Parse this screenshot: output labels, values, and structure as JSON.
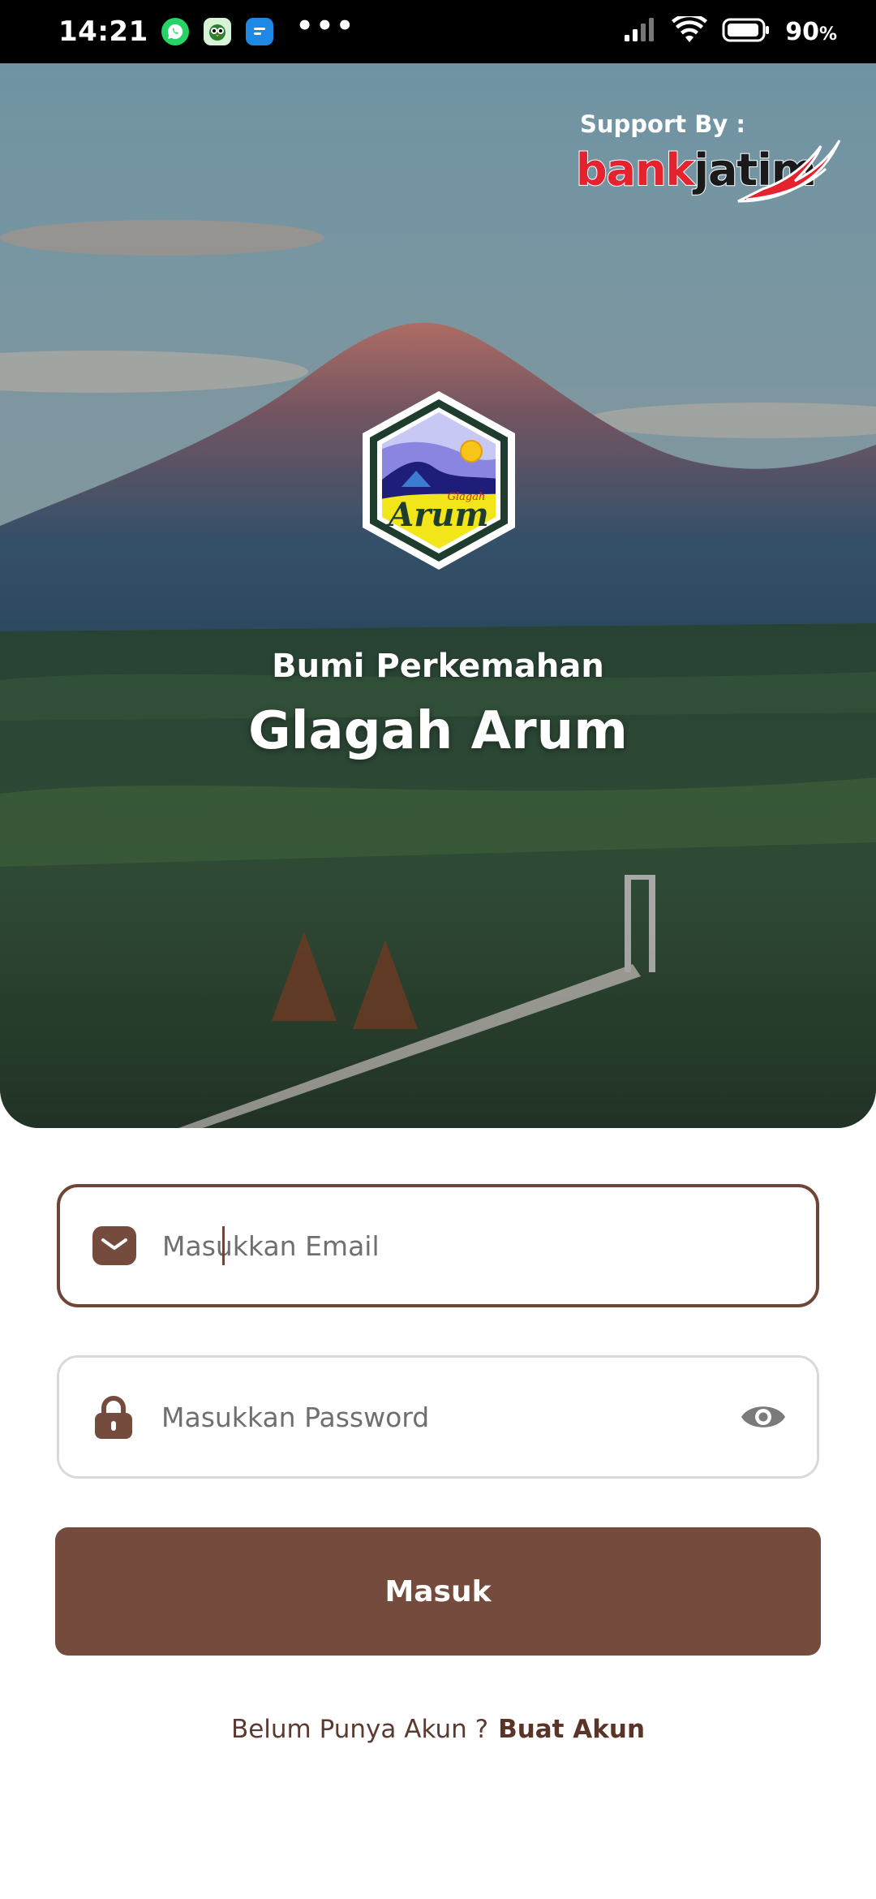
{
  "status_bar": {
    "time": "14:21",
    "more": "•••",
    "battery": "90"
  },
  "hero": {
    "support_label": "Support By :",
    "bank_logo_part1": "bank",
    "bank_logo_part2": "jatim",
    "badge_text": "Arum",
    "badge_small_text": "Glagah",
    "subtitle": "Bumi Perkemahan",
    "title": "Glagah Arum"
  },
  "form": {
    "email_placeholder": "Masukkan Email",
    "password_placeholder": "Masukkan Password",
    "login_label": "Masuk"
  },
  "register": {
    "prompt": "Belum Punya Akun ?",
    "link": "Buat Akun"
  },
  "colors": {
    "primary": "#744b3c",
    "email_border": "#6e4538",
    "password_border": "#d9d9d9"
  }
}
